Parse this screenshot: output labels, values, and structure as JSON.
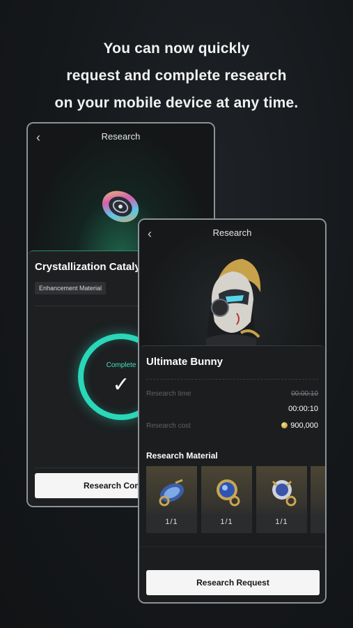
{
  "headline": {
    "line1": "You can now quickly",
    "line2": "request and complete research",
    "line3": "on your mobile device at any time."
  },
  "back_screen": {
    "back_symbol": "‹",
    "title": "Research",
    "item_name": "Crystallization Catalyst",
    "tag": "Enhancement Material",
    "status_label": "Complete",
    "check_symbol": "✓",
    "button_label": "Research Complete"
  },
  "front_screen": {
    "back_symbol": "‹",
    "title": "Research",
    "item_name": "Ultimate Bunny",
    "research_time_label": "Research time",
    "research_time_original": "00:00:10",
    "research_time_value": "00:00:10",
    "research_cost_label": "Research cost",
    "research_cost_value": "900,000",
    "materials_label": "Research Material",
    "materials": [
      {
        "qty": "1/1",
        "icon": "material-icon"
      },
      {
        "qty": "1/1",
        "icon": "material-icon"
      },
      {
        "qty": "1/1",
        "icon": "material-icon"
      }
    ],
    "button_label": "Research Request"
  },
  "colors": {
    "accent": "#2ad7b8",
    "background": "#15181b",
    "button": "#f5f5f5"
  }
}
